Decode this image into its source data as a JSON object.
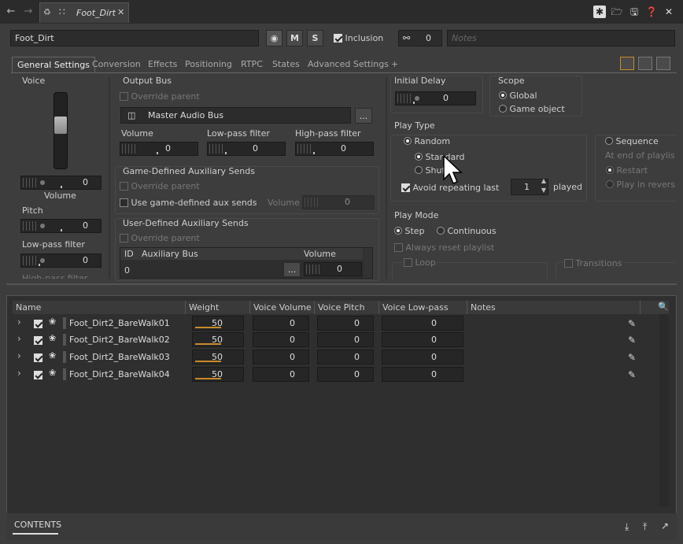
{
  "document_tab": "Foot_Dirt",
  "object_name": "Foot_Dirt",
  "mute_label": "M",
  "solo_label": "S",
  "inclusion_label": "Inclusion",
  "share_count": "0",
  "notes_placeholder": "Notes",
  "tabs": [
    "General Settings",
    "Conversion",
    "Effects",
    "Positioning",
    "RTPC",
    "States",
    "Advanced Settings",
    "+"
  ],
  "voice": {
    "title": "Voice",
    "volume_value": "0",
    "volume_label": "Volume",
    "pitch_label": "Pitch",
    "pitch_value": "0",
    "lpf_label": "Low-pass filter",
    "lpf_value": "0",
    "hpf_label": "High-pass filter"
  },
  "output_bus": {
    "title": "Output Bus",
    "override": "Override parent",
    "bus": "Master Audio Bus",
    "browse": "...",
    "volume_label": "Volume",
    "volume_value": "0",
    "lpf_label": "Low-pass filter",
    "lpf_value": "0",
    "hpf_label": "High-pass filter",
    "hpf_value": "0"
  },
  "game_aux": {
    "title": "Game-Defined Auxiliary Sends",
    "override": "Override parent",
    "use_label": "Use game-defined aux sends",
    "volume_label": "Volume",
    "volume_value": "0"
  },
  "user_aux": {
    "title": "User-Defined Auxiliary Sends",
    "override": "Override parent",
    "col_id": "ID",
    "col_bus": "Auxiliary Bus",
    "col_volume": "Volume",
    "row_id": "0",
    "row_browse": "...",
    "row_volume": "0"
  },
  "initial_delay": {
    "title": "Initial Delay",
    "value": "0"
  },
  "scope": {
    "title": "Scope",
    "global": "Global",
    "game_object": "Game object"
  },
  "play_type": {
    "title": "Play Type",
    "random": "Random",
    "standard": "Standard",
    "shuffle": "Shuffle",
    "avoid": "Avoid repeating last",
    "avoid_count": "1",
    "played": "played",
    "sequence": "Sequence",
    "at_end": "At end of playlis",
    "restart": "Restart",
    "play_reverse": "Play in revers"
  },
  "play_mode": {
    "title": "Play Mode",
    "step": "Step",
    "continuous": "Continuous",
    "always_reset": "Always reset playlist",
    "loop": "Loop",
    "transitions": "Transitions"
  },
  "list": {
    "headers": [
      "Name",
      "Weight",
      "Voice Volume",
      "Voice Pitch",
      "Voice Low-pass Filter",
      "Notes"
    ],
    "rows": [
      {
        "name": "Foot_Dirt2_BareWalk01",
        "weight": "50",
        "volume": "0",
        "pitch": "0",
        "lpf": "0"
      },
      {
        "name": "Foot_Dirt2_BareWalk02",
        "weight": "50",
        "volume": "0",
        "pitch": "0",
        "lpf": "0"
      },
      {
        "name": "Foot_Dirt2_BareWalk03",
        "weight": "50",
        "volume": "0",
        "pitch": "0",
        "lpf": "0"
      },
      {
        "name": "Foot_Dirt2_BareWalk04",
        "weight": "50",
        "volume": "0",
        "pitch": "0",
        "lpf": "0"
      }
    ]
  },
  "bottom_tab": "CONTENTS",
  "colors": {
    "accent": "#c88a2a",
    "bg": "#3d3d3d",
    "panel": "#2f2f2f"
  }
}
